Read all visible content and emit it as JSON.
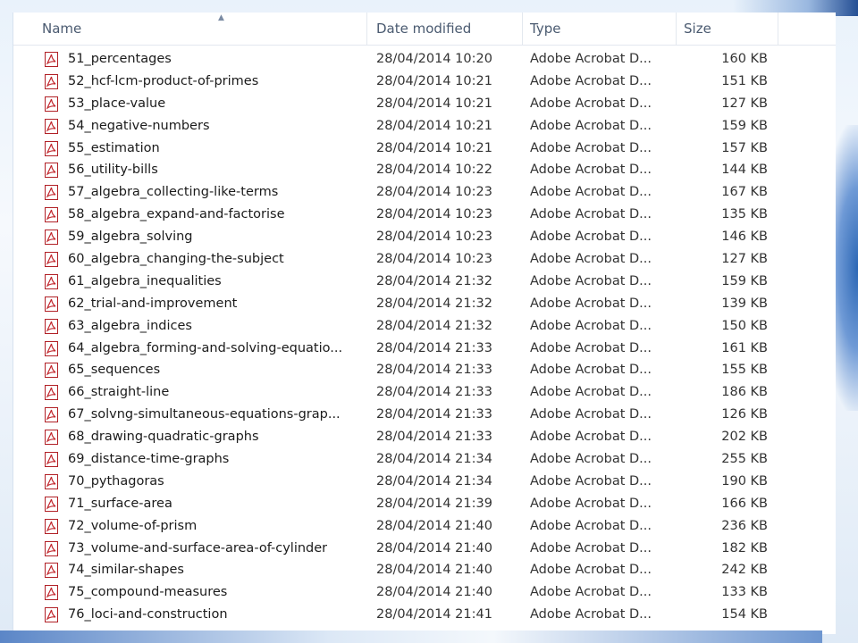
{
  "columns": {
    "name": "Name",
    "date": "Date modified",
    "type": "Type",
    "size": "Size"
  },
  "sort_indicator": "▲",
  "files": [
    {
      "name": "51_percentages",
      "date": "28/04/2014 10:20",
      "type": "Adobe Acrobat D...",
      "size": "160 KB"
    },
    {
      "name": "52_hcf-lcm-product-of-primes",
      "date": "28/04/2014 10:21",
      "type": "Adobe Acrobat D...",
      "size": "151 KB"
    },
    {
      "name": "53_place-value",
      "date": "28/04/2014 10:21",
      "type": "Adobe Acrobat D...",
      "size": "127 KB"
    },
    {
      "name": "54_negative-numbers",
      "date": "28/04/2014 10:21",
      "type": "Adobe Acrobat D...",
      "size": "159 KB"
    },
    {
      "name": "55_estimation",
      "date": "28/04/2014 10:21",
      "type": "Adobe Acrobat D...",
      "size": "157 KB"
    },
    {
      "name": "56_utility-bills",
      "date": "28/04/2014 10:22",
      "type": "Adobe Acrobat D...",
      "size": "144 KB"
    },
    {
      "name": "57_algebra_collecting-like-terms",
      "date": "28/04/2014 10:23",
      "type": "Adobe Acrobat D...",
      "size": "167 KB"
    },
    {
      "name": "58_algebra_expand-and-factorise",
      "date": "28/04/2014 10:23",
      "type": "Adobe Acrobat D...",
      "size": "135 KB"
    },
    {
      "name": "59_algebra_solving",
      "date": "28/04/2014 10:23",
      "type": "Adobe Acrobat D...",
      "size": "146 KB"
    },
    {
      "name": "60_algebra_changing-the-subject",
      "date": "28/04/2014 10:23",
      "type": "Adobe Acrobat D...",
      "size": "127 KB"
    },
    {
      "name": "61_algebra_inequalities",
      "date": "28/04/2014 21:32",
      "type": "Adobe Acrobat D...",
      "size": "159 KB"
    },
    {
      "name": "62_trial-and-improvement",
      "date": "28/04/2014 21:32",
      "type": "Adobe Acrobat D...",
      "size": "139 KB"
    },
    {
      "name": "63_algebra_indices",
      "date": "28/04/2014 21:32",
      "type": "Adobe Acrobat D...",
      "size": "150 KB"
    },
    {
      "name": "64_algebra_forming-and-solving-equatio...",
      "date": "28/04/2014 21:33",
      "type": "Adobe Acrobat D...",
      "size": "161 KB"
    },
    {
      "name": "65_sequences",
      "date": "28/04/2014 21:33",
      "type": "Adobe Acrobat D...",
      "size": "155 KB"
    },
    {
      "name": "66_straight-line",
      "date": "28/04/2014 21:33",
      "type": "Adobe Acrobat D...",
      "size": "186 KB"
    },
    {
      "name": "67_solvng-simultaneous-equations-grap...",
      "date": "28/04/2014 21:33",
      "type": "Adobe Acrobat D...",
      "size": "126 KB"
    },
    {
      "name": "68_drawing-quadratic-graphs",
      "date": "28/04/2014 21:33",
      "type": "Adobe Acrobat D...",
      "size": "202 KB"
    },
    {
      "name": "69_distance-time-graphs",
      "date": "28/04/2014 21:34",
      "type": "Adobe Acrobat D...",
      "size": "255 KB"
    },
    {
      "name": "70_pythagoras",
      "date": "28/04/2014 21:34",
      "type": "Adobe Acrobat D...",
      "size": "190 KB"
    },
    {
      "name": "71_surface-area",
      "date": "28/04/2014 21:39",
      "type": "Adobe Acrobat D...",
      "size": "166 KB"
    },
    {
      "name": "72_volume-of-prism",
      "date": "28/04/2014 21:40",
      "type": "Adobe Acrobat D...",
      "size": "236 KB"
    },
    {
      "name": "73_volume-and-surface-area-of-cylinder",
      "date": "28/04/2014 21:40",
      "type": "Adobe Acrobat D...",
      "size": "182 KB"
    },
    {
      "name": "74_similar-shapes",
      "date": "28/04/2014 21:40",
      "type": "Adobe Acrobat D...",
      "size": "242 KB"
    },
    {
      "name": "75_compound-measures",
      "date": "28/04/2014 21:40",
      "type": "Adobe Acrobat D...",
      "size": "133 KB"
    },
    {
      "name": "76_loci-and-construction",
      "date": "28/04/2014 21:41",
      "type": "Adobe Acrobat D...",
      "size": "154 KB"
    }
  ],
  "icon": "pdf-file-icon",
  "colors": {
    "pdf_red": "#c1272d",
    "header_text": "#4a5a70"
  }
}
